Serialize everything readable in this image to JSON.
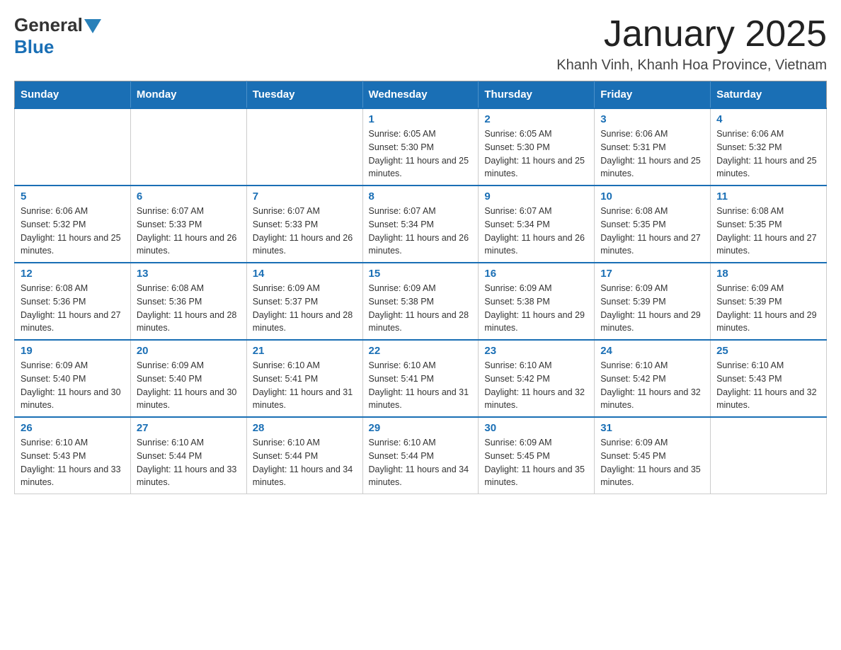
{
  "header": {
    "logo_general": "General",
    "logo_blue": "Blue",
    "month_title": "January 2025",
    "location": "Khanh Vinh, Khanh Hoa Province, Vietnam"
  },
  "calendar": {
    "days_of_week": [
      "Sunday",
      "Monday",
      "Tuesday",
      "Wednesday",
      "Thursday",
      "Friday",
      "Saturday"
    ],
    "weeks": [
      [
        {
          "day": "",
          "info": ""
        },
        {
          "day": "",
          "info": ""
        },
        {
          "day": "",
          "info": ""
        },
        {
          "day": "1",
          "info": "Sunrise: 6:05 AM\nSunset: 5:30 PM\nDaylight: 11 hours and 25 minutes."
        },
        {
          "day": "2",
          "info": "Sunrise: 6:05 AM\nSunset: 5:30 PM\nDaylight: 11 hours and 25 minutes."
        },
        {
          "day": "3",
          "info": "Sunrise: 6:06 AM\nSunset: 5:31 PM\nDaylight: 11 hours and 25 minutes."
        },
        {
          "day": "4",
          "info": "Sunrise: 6:06 AM\nSunset: 5:32 PM\nDaylight: 11 hours and 25 minutes."
        }
      ],
      [
        {
          "day": "5",
          "info": "Sunrise: 6:06 AM\nSunset: 5:32 PM\nDaylight: 11 hours and 25 minutes."
        },
        {
          "day": "6",
          "info": "Sunrise: 6:07 AM\nSunset: 5:33 PM\nDaylight: 11 hours and 26 minutes."
        },
        {
          "day": "7",
          "info": "Sunrise: 6:07 AM\nSunset: 5:33 PM\nDaylight: 11 hours and 26 minutes."
        },
        {
          "day": "8",
          "info": "Sunrise: 6:07 AM\nSunset: 5:34 PM\nDaylight: 11 hours and 26 minutes."
        },
        {
          "day": "9",
          "info": "Sunrise: 6:07 AM\nSunset: 5:34 PM\nDaylight: 11 hours and 26 minutes."
        },
        {
          "day": "10",
          "info": "Sunrise: 6:08 AM\nSunset: 5:35 PM\nDaylight: 11 hours and 27 minutes."
        },
        {
          "day": "11",
          "info": "Sunrise: 6:08 AM\nSunset: 5:35 PM\nDaylight: 11 hours and 27 minutes."
        }
      ],
      [
        {
          "day": "12",
          "info": "Sunrise: 6:08 AM\nSunset: 5:36 PM\nDaylight: 11 hours and 27 minutes."
        },
        {
          "day": "13",
          "info": "Sunrise: 6:08 AM\nSunset: 5:36 PM\nDaylight: 11 hours and 28 minutes."
        },
        {
          "day": "14",
          "info": "Sunrise: 6:09 AM\nSunset: 5:37 PM\nDaylight: 11 hours and 28 minutes."
        },
        {
          "day": "15",
          "info": "Sunrise: 6:09 AM\nSunset: 5:38 PM\nDaylight: 11 hours and 28 minutes."
        },
        {
          "day": "16",
          "info": "Sunrise: 6:09 AM\nSunset: 5:38 PM\nDaylight: 11 hours and 29 minutes."
        },
        {
          "day": "17",
          "info": "Sunrise: 6:09 AM\nSunset: 5:39 PM\nDaylight: 11 hours and 29 minutes."
        },
        {
          "day": "18",
          "info": "Sunrise: 6:09 AM\nSunset: 5:39 PM\nDaylight: 11 hours and 29 minutes."
        }
      ],
      [
        {
          "day": "19",
          "info": "Sunrise: 6:09 AM\nSunset: 5:40 PM\nDaylight: 11 hours and 30 minutes."
        },
        {
          "day": "20",
          "info": "Sunrise: 6:09 AM\nSunset: 5:40 PM\nDaylight: 11 hours and 30 minutes."
        },
        {
          "day": "21",
          "info": "Sunrise: 6:10 AM\nSunset: 5:41 PM\nDaylight: 11 hours and 31 minutes."
        },
        {
          "day": "22",
          "info": "Sunrise: 6:10 AM\nSunset: 5:41 PM\nDaylight: 11 hours and 31 minutes."
        },
        {
          "day": "23",
          "info": "Sunrise: 6:10 AM\nSunset: 5:42 PM\nDaylight: 11 hours and 32 minutes."
        },
        {
          "day": "24",
          "info": "Sunrise: 6:10 AM\nSunset: 5:42 PM\nDaylight: 11 hours and 32 minutes."
        },
        {
          "day": "25",
          "info": "Sunrise: 6:10 AM\nSunset: 5:43 PM\nDaylight: 11 hours and 32 minutes."
        }
      ],
      [
        {
          "day": "26",
          "info": "Sunrise: 6:10 AM\nSunset: 5:43 PM\nDaylight: 11 hours and 33 minutes."
        },
        {
          "day": "27",
          "info": "Sunrise: 6:10 AM\nSunset: 5:44 PM\nDaylight: 11 hours and 33 minutes."
        },
        {
          "day": "28",
          "info": "Sunrise: 6:10 AM\nSunset: 5:44 PM\nDaylight: 11 hours and 34 minutes."
        },
        {
          "day": "29",
          "info": "Sunrise: 6:10 AM\nSunset: 5:44 PM\nDaylight: 11 hours and 34 minutes."
        },
        {
          "day": "30",
          "info": "Sunrise: 6:09 AM\nSunset: 5:45 PM\nDaylight: 11 hours and 35 minutes."
        },
        {
          "day": "31",
          "info": "Sunrise: 6:09 AM\nSunset: 5:45 PM\nDaylight: 11 hours and 35 minutes."
        },
        {
          "day": "",
          "info": ""
        }
      ]
    ]
  }
}
